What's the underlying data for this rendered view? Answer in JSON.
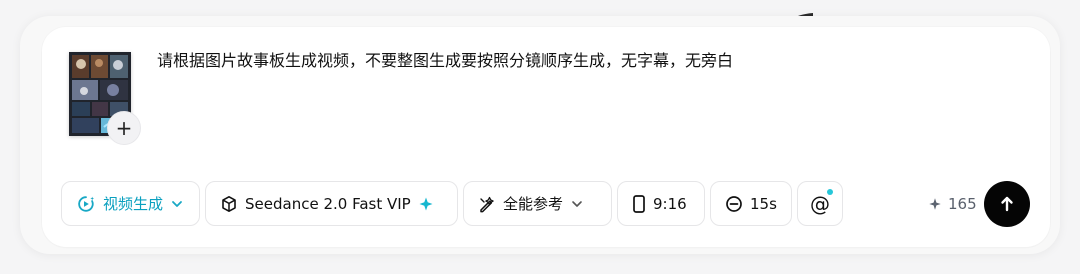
{
  "prompt": {
    "text": "请根据图片故事板生成视频，不要整图生成要按照分镜顺序生成，无字幕，无旁白"
  },
  "attachment": {
    "add_label": "+"
  },
  "toolbar": {
    "video_mode_label": "视频生成",
    "model_label": "Seedance 2.0 Fast VIP",
    "reference_label": "全能参考",
    "aspect_ratio_label": "9:16",
    "duration_label": "15s",
    "mention_label": "@"
  },
  "footer": {
    "credits_value": "165"
  },
  "icons": {
    "video_mode": "video-spark-icon",
    "dropdown": "chevron-down-icon",
    "model": "cube-icon",
    "model_badge": "sparkle-icon",
    "reference": "wand-pen-icon",
    "ratio": "portrait-rectangle-icon",
    "duration": "minus-circle-icon",
    "mention": "at-sign-icon",
    "credits": "sparkle-icon",
    "send": "arrow-up-icon",
    "add": "plus-icon"
  },
  "colors": {
    "accent": "#17a7c1",
    "send_button": "#050505",
    "notification_dot": "#26c7d9",
    "surface": "#ffffff",
    "background": "#f5f5f6",
    "border": "#e6e6e8"
  }
}
